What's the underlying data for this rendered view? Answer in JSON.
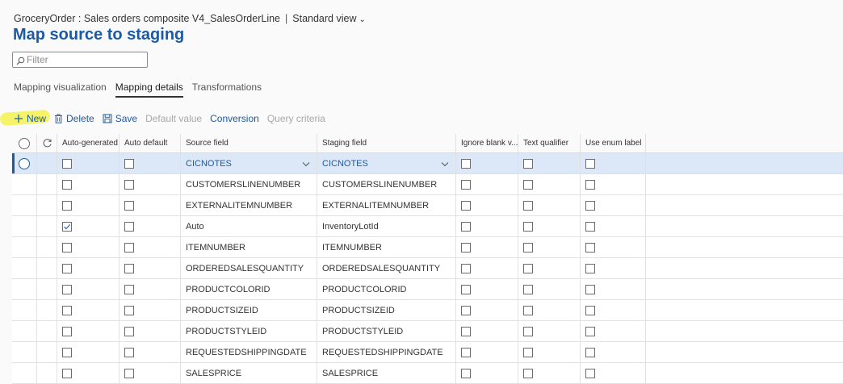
{
  "breadcrumb": {
    "context": "GroceryOrder : Sales orders composite V4_SalesOrderLine",
    "separator": "|",
    "view": "Standard view"
  },
  "title": "Map source to staging",
  "filter": {
    "placeholder": "Filter",
    "value": ""
  },
  "tabs": [
    {
      "label": "Mapping visualization",
      "active": false
    },
    {
      "label": "Mapping details",
      "active": true
    },
    {
      "label": "Transformations",
      "active": false
    }
  ],
  "toolbar": {
    "new_label": "New",
    "delete_label": "Delete",
    "save_label": "Save",
    "default_value_label": "Default value",
    "conversion_label": "Conversion",
    "query_criteria_label": "Query criteria"
  },
  "grid": {
    "columns": {
      "auto_generated": "Auto-generated",
      "auto_default": "Auto default",
      "source_field": "Source field",
      "staging_field": "Staging field",
      "ignore_blank": "Ignore blank v...",
      "text_qualifier": "Text qualifier",
      "use_enum_label": "Use enum label"
    },
    "rows": [
      {
        "source": "CICNOTES",
        "staging": "CICNOTES",
        "auto_generated": false,
        "selected": true
      },
      {
        "source": "CUSTOMERSLINENUMBER",
        "staging": "CUSTOMERSLINENUMBER",
        "auto_generated": false
      },
      {
        "source": "EXTERNALITEMNUMBER",
        "staging": "EXTERNALITEMNUMBER",
        "auto_generated": false
      },
      {
        "source": "Auto",
        "staging": "InventoryLotId",
        "auto_generated": true
      },
      {
        "source": "ITEMNUMBER",
        "staging": "ITEMNUMBER",
        "auto_generated": false
      },
      {
        "source": "ORDEREDSALESQUANTITY",
        "staging": "ORDEREDSALESQUANTITY",
        "auto_generated": false
      },
      {
        "source": "PRODUCTCOLORID",
        "staging": "PRODUCTCOLORID",
        "auto_generated": false
      },
      {
        "source": "PRODUCTSIZEID",
        "staging": "PRODUCTSIZEID",
        "auto_generated": false
      },
      {
        "source": "PRODUCTSTYLEID",
        "staging": "PRODUCTSTYLEID",
        "auto_generated": false
      },
      {
        "source": "REQUESTEDSHIPPINGDATE",
        "staging": "REQUESTEDSHIPPINGDATE",
        "auto_generated": false
      },
      {
        "source": "SALESPRICE",
        "staging": "SALESPRICE",
        "auto_generated": false
      }
    ]
  },
  "colors": {
    "accent": "#1b5aa6",
    "selected_row": "#dce8f7",
    "highlighter": "#f3f01a",
    "disabled_text": "#a8a8a8"
  },
  "icons": {
    "filter": "search-icon",
    "view_dropdown": "chevron-down-icon",
    "new": "plus-icon",
    "delete": "trash-icon",
    "save": "save-icon",
    "select_all": "radio-icon",
    "refresh": "refresh-icon",
    "field_dropdown": "chevron-down-icon"
  }
}
